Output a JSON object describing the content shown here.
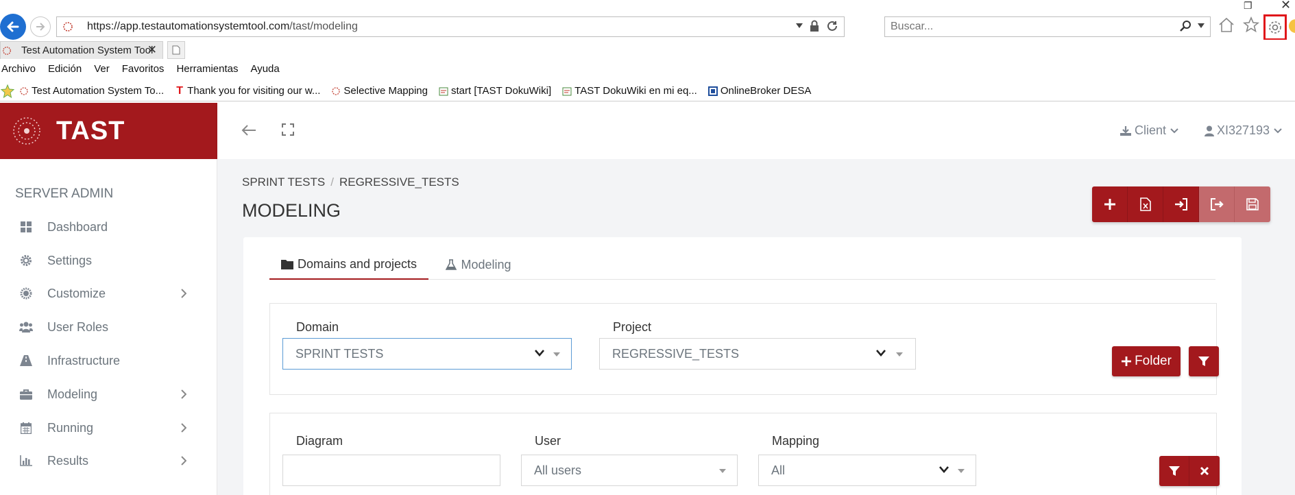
{
  "browser": {
    "url_prefix": "https://app.",
    "url_domain": "testautomationsystemtool.com",
    "url_path": "/tast/modeling",
    "search_placeholder": "Buscar...",
    "tab_title": "Test Automation System Tool",
    "menu": [
      "Archivo",
      "Edición",
      "Ver",
      "Favoritos",
      "Herramientas",
      "Ayuda"
    ],
    "favorites": [
      {
        "label": "Test Automation System To...",
        "icon": "tast-favicon"
      },
      {
        "label": "Thank you for visiting our w...",
        "icon": "t-logo-icon"
      },
      {
        "label": "Selective Mapping",
        "icon": "tast-favicon"
      },
      {
        "label": "start [TAST DokuWiki]",
        "icon": "wiki-icon"
      },
      {
        "label": "TAST DokuWiki en mi eq...",
        "icon": "wiki-icon"
      },
      {
        "label": "OnlineBroker DESA",
        "icon": "square-icon"
      }
    ]
  },
  "app": {
    "brand": "TAST",
    "client_label": "Client",
    "user_label": "XI327193",
    "accent_color": "#a3191d"
  },
  "sidebar": {
    "section_title": "SERVER ADMIN",
    "items": [
      {
        "label": "Dashboard",
        "icon": "dashboard-icon",
        "has_submenu": false
      },
      {
        "label": "Settings",
        "icon": "gear-icon",
        "has_submenu": false
      },
      {
        "label": "Customize",
        "icon": "cog-icon",
        "has_submenu": true
      },
      {
        "label": "User Roles",
        "icon": "users-icon",
        "has_submenu": false
      },
      {
        "label": "Infrastructure",
        "icon": "road-icon",
        "has_submenu": false
      },
      {
        "label": "Modeling",
        "icon": "briefcase-icon",
        "has_submenu": true
      },
      {
        "label": "Running",
        "icon": "calendar-icon",
        "has_submenu": true
      },
      {
        "label": "Results",
        "icon": "bar-chart-icon",
        "has_submenu": true
      }
    ]
  },
  "main": {
    "breadcrumb": [
      "SPRINT TESTS",
      "REGRESSIVE_TESTS"
    ],
    "breadcrumb_sep": "/",
    "title": "MODELING",
    "tabs": [
      {
        "label": "Domains and projects",
        "active": true
      },
      {
        "label": "Modeling",
        "active": false
      }
    ],
    "filters1": {
      "domain_label": "Domain",
      "domain_value": "SPRINT TESTS",
      "project_label": "Project",
      "project_value": "REGRESSIVE_TESTS",
      "folder_button": "Folder"
    },
    "filters2": {
      "diagram_label": "Diagram",
      "diagram_value": "",
      "user_label": "User",
      "user_value": "All users",
      "mapping_label": "Mapping",
      "mapping_value": "All"
    }
  }
}
